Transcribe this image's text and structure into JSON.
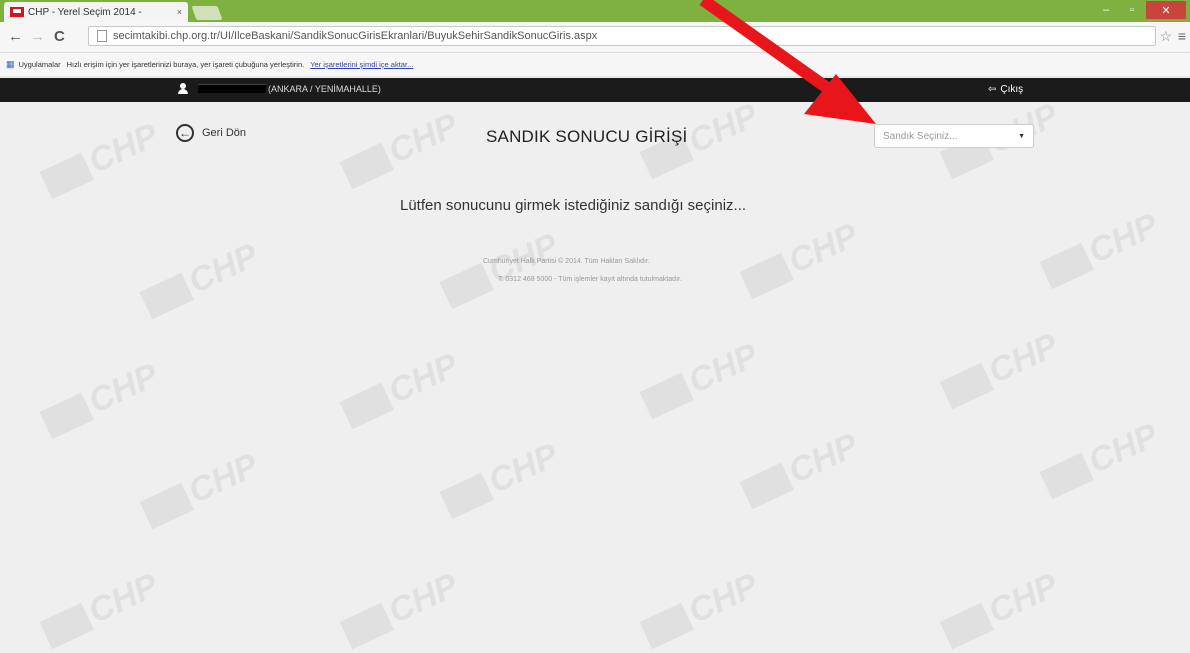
{
  "browser": {
    "tab_title": "CHP - Yerel Seçim 2014 - ",
    "tab_close": "×",
    "window_controls": {
      "minimize": "–",
      "maximize": "▫",
      "close": "✕"
    },
    "url": "secimtakibi.chp.org.tr/UI/IlceBaskani/SandikSonucGirisEkranlari/BuyukSehirSandikSonucGiris.aspx",
    "bookmarks": {
      "apps_label": "Uygulamalar",
      "hint": "Hızlı erişim için yer işaretlerinizi buraya, yer işareti çubuğuna yerleştirin.",
      "import_link": "Yer işaretlerini şimdi içe aktar..."
    }
  },
  "appbar": {
    "user_location": "(ANKARA / YENİMAHALLE)",
    "logout_label": "Çıkış",
    "logout_icon": "sign-out-icon"
  },
  "page": {
    "back_label": "Geri Dön",
    "title": "SANDIK SONUCU GİRİŞİ",
    "select_placeholder": "Sandık Seçiniz...",
    "message": "Lütfen sonucunu girmek istediğiniz sandığı seçiniz...",
    "footer_line1": "Cumhuriyet Halk Partisi © 2014. Tüm Hakları Saklıdır.",
    "footer_line2": "T: 0312 468 5000 - Tüm işlemler kayıt altında tutulmaktadır."
  },
  "watermark_text": "CHP",
  "colors": {
    "tabstrip": "#7eb140",
    "appbar": "#1b1b1b",
    "arrow": "#e8161b",
    "background": "#efefef"
  }
}
